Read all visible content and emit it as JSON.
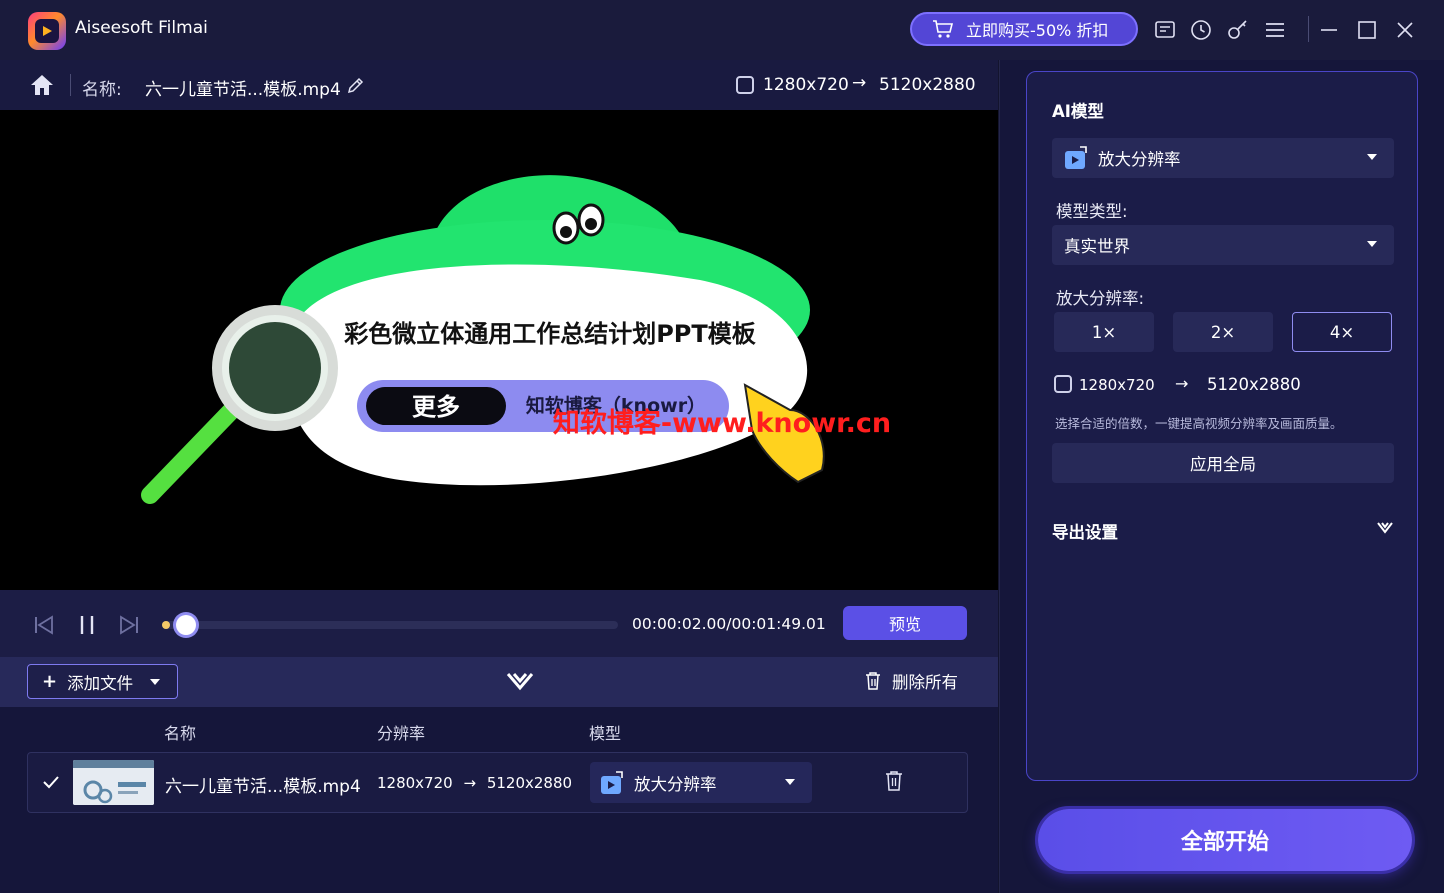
{
  "app": {
    "title": "Aiseesoft Filmai"
  },
  "titlebar": {
    "buy_label": "立即购买-50% 折扣",
    "icons": [
      "cart-icon",
      "feedback-icon",
      "history-icon",
      "key-icon",
      "menu-icon",
      "minimize-icon",
      "maximize-icon",
      "close-icon"
    ]
  },
  "crumb": {
    "name_label": "名称:",
    "file_name": "六一儿童节活...模板.mp4",
    "res_from": "1280x720",
    "res_to": "5120x2880"
  },
  "video": {
    "title_text": "彩色微立体通用工作总结计划PPT模板",
    "button_text": "更多",
    "pill_text": "知软博客（knowr）",
    "watermark": "知软博客-www.knowr.cn"
  },
  "player": {
    "time": "00:00:02.00/00:01:49.01",
    "progress": 0.018,
    "preview_label": "预览"
  },
  "file_toolbar": {
    "add_label": "添加文件",
    "delete_all_label": "删除所有"
  },
  "list": {
    "headers": {
      "name": "名称",
      "resolution": "分辨率",
      "model": "模型"
    },
    "rows": [
      {
        "name": "六一儿童节活...模板.mp4",
        "res_from": "1280x720",
        "res_to": "5120x2880",
        "model": "放大分辨率",
        "checked": true
      }
    ]
  },
  "ai_panel": {
    "heading": "AI模型",
    "model_value": "放大分辨率",
    "model_type_label": "模型类型:",
    "model_type_value": "真实世界",
    "upscale_label": "放大分辨率:",
    "scales": [
      "1×",
      "2×",
      "4×"
    ],
    "active_scale": "4×",
    "res_from": "1280x720",
    "res_to": "5120x2880",
    "hint": "选择合适的倍数，一键提高视频分辨率及画面质量。",
    "apply_all_label": "应用全局",
    "export_label": "导出设置"
  },
  "start_all_label": "全部开始",
  "colors": {
    "accent": "#5b50e6",
    "panel_border": "#4a45c8",
    "bg": "#15163a"
  }
}
